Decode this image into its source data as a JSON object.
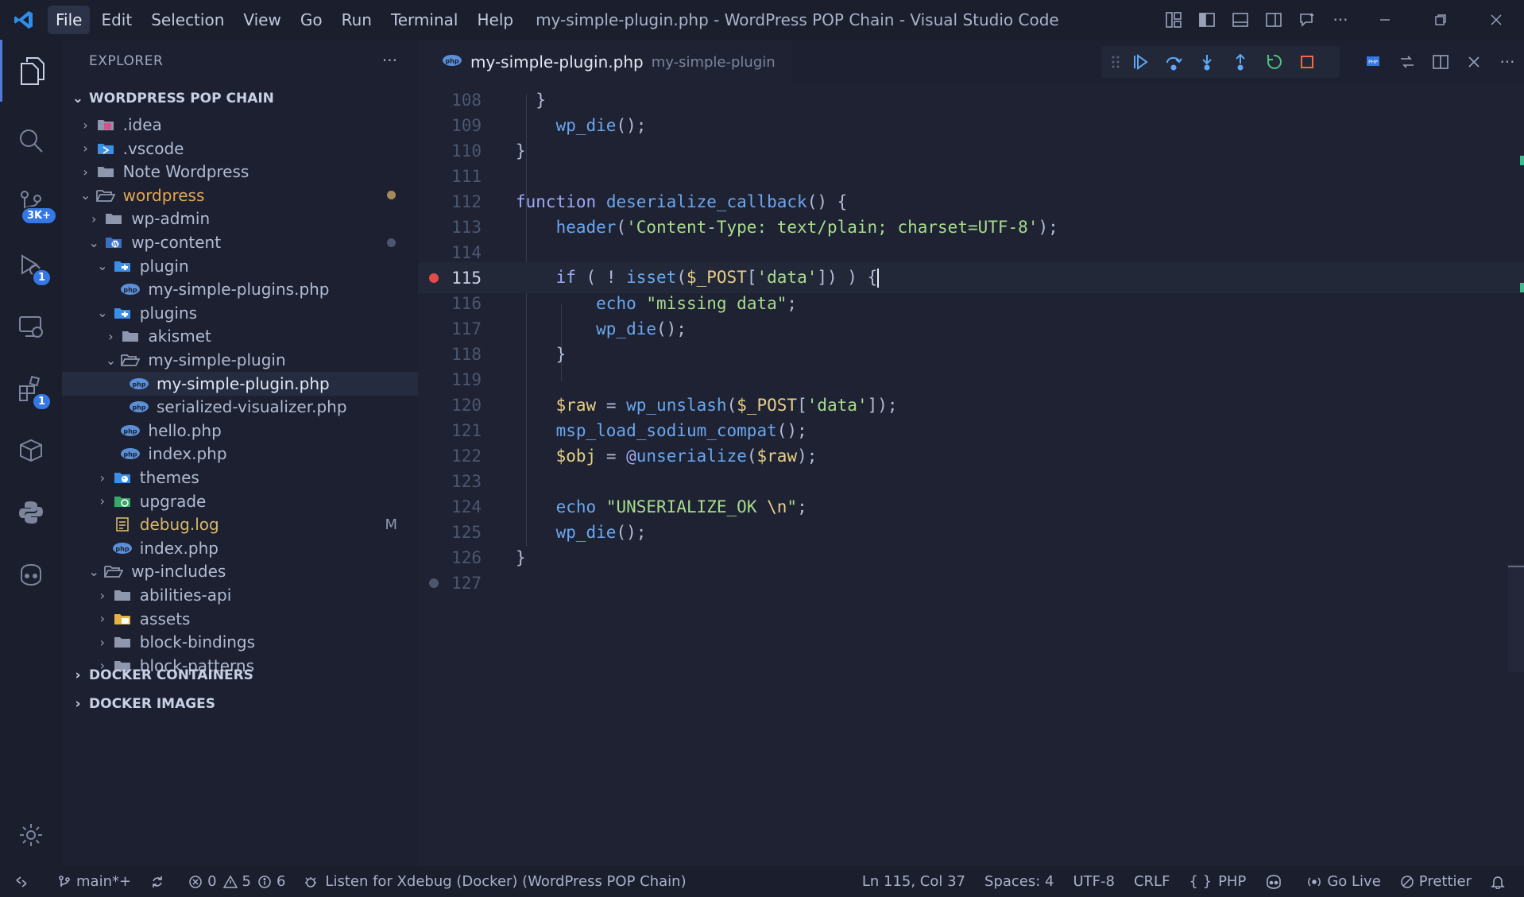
{
  "titlebar": {
    "menu": [
      "File",
      "Edit",
      "Selection",
      "View",
      "Go",
      "Run",
      "Terminal",
      "Help"
    ],
    "window_title": "my-simple-plugin.php - WordPress POP Chain - Visual Studio Code"
  },
  "activity": {
    "source_control_badge": "3K+",
    "run_debug_badge": "1",
    "extensions_badge": "1"
  },
  "sidebar": {
    "title": "EXPLORER",
    "root": "WORDPRESS POP CHAIN",
    "tree": [
      {
        "label": ".idea"
      },
      {
        "label": ".vscode"
      },
      {
        "label": "Note Wordpress"
      },
      {
        "label": "wordpress"
      },
      {
        "label": "wp-admin"
      },
      {
        "label": "wp-content"
      },
      {
        "label": "plugin"
      },
      {
        "label": "my-simple-plugins.php"
      },
      {
        "label": "plugins"
      },
      {
        "label": "akismet"
      },
      {
        "label": "my-simple-plugin"
      },
      {
        "label": "my-simple-plugin.php"
      },
      {
        "label": "serialized-visualizer.php"
      },
      {
        "label": "hello.php"
      },
      {
        "label": "index.php"
      },
      {
        "label": "themes"
      },
      {
        "label": "upgrade"
      },
      {
        "label": "debug.log",
        "status": "M"
      },
      {
        "label": "index.php"
      },
      {
        "label": "wp-includes"
      },
      {
        "label": "abilities-api"
      },
      {
        "label": "assets"
      },
      {
        "label": "block-bindings"
      },
      {
        "label": "block-patterns"
      }
    ],
    "sections": [
      "DOCKER CONTAINERS",
      "DOCKER IMAGES"
    ]
  },
  "editor": {
    "tab_name": "my-simple-plugin.php",
    "tab_desc": "my-simple-plugin",
    "line_numbers": [
      "108",
      "109",
      "110",
      "111",
      "112",
      "113",
      "114",
      "115",
      "116",
      "117",
      "118",
      "119",
      "120",
      "121",
      "122",
      "123",
      "124",
      "125",
      "126",
      "127"
    ]
  },
  "statusbar": {
    "branch": "main*+",
    "errors": "0",
    "warnings": "5",
    "info": "6",
    "debug": "Listen for Xdebug (Docker) (WordPress POP Chain)",
    "position": "Ln 115, Col 37",
    "spaces": "Spaces: 4",
    "encoding": "UTF-8",
    "eol": "CRLF",
    "language": "PHP",
    "golive": "Go Live",
    "prettier": "Prettier"
  },
  "colors": {
    "accent": "#3578e5",
    "breakpoint": "#e5484d",
    "modified_dot": "#a38c5a"
  }
}
